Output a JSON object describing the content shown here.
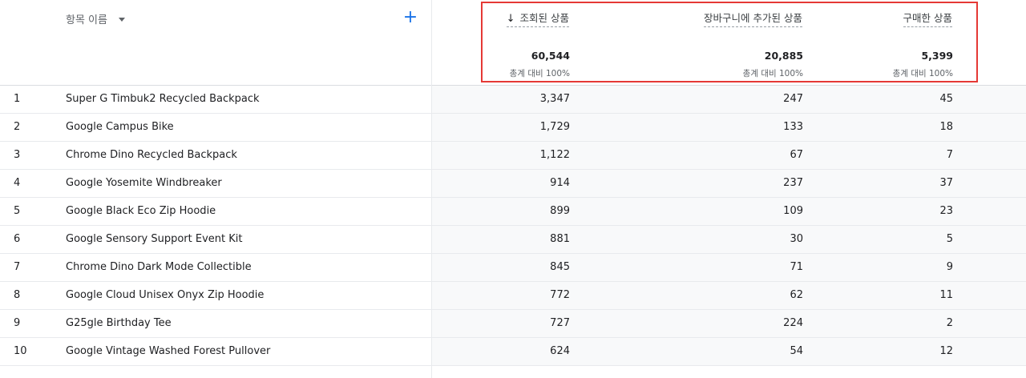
{
  "header": {
    "dimension_label": "항목 이름",
    "add_label": "+",
    "sort_arrow": "↓",
    "metrics": [
      {
        "label": "조회된 상품",
        "total": "60,544",
        "pct": "총계 대비 100%"
      },
      {
        "label": "장바구니에 추가된 상품",
        "total": "20,885",
        "pct": "총계 대비 100%"
      },
      {
        "label": "구매한 상품",
        "total": "5,399",
        "pct": "총계 대비 100%"
      }
    ]
  },
  "rows": [
    {
      "index": "1",
      "name": "Super G Timbuk2 Recycled Backpack",
      "v1": "3,347",
      "v2": "247",
      "v3": "45"
    },
    {
      "index": "2",
      "name": "Google Campus Bike",
      "v1": "1,729",
      "v2": "133",
      "v3": "18"
    },
    {
      "index": "3",
      "name": "Chrome Dino Recycled Backpack",
      "v1": "1,122",
      "v2": "67",
      "v3": "7"
    },
    {
      "index": "4",
      "name": "Google Yosemite Windbreaker",
      "v1": "914",
      "v2": "237",
      "v3": "37"
    },
    {
      "index": "5",
      "name": "Google Black Eco Zip Hoodie",
      "v1": "899",
      "v2": "109",
      "v3": "23"
    },
    {
      "index": "6",
      "name": "Google Sensory Support Event Kit",
      "v1": "881",
      "v2": "30",
      "v3": "5"
    },
    {
      "index": "7",
      "name": "Chrome Dino Dark Mode Collectible",
      "v1": "845",
      "v2": "71",
      "v3": "9"
    },
    {
      "index": "8",
      "name": "Google Cloud Unisex Onyx Zip Hoodie",
      "v1": "772",
      "v2": "62",
      "v3": "11"
    },
    {
      "index": "9",
      "name": "G25gle Birthday Tee",
      "v1": "727",
      "v2": "224",
      "v3": "2"
    },
    {
      "index": "10",
      "name": "Google Vintage Washed Forest Pullover",
      "v1": "624",
      "v2": "54",
      "v3": "12"
    }
  ],
  "colors": {
    "accent": "#1a73e8",
    "highlight": "#e53935",
    "zebra": "#f8f9fa"
  }
}
